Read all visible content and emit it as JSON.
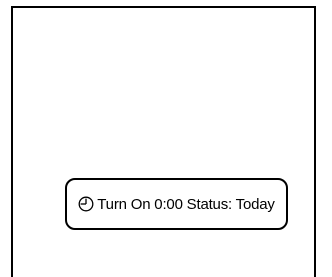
{
  "timer": {
    "icon": "clock-icon",
    "text": "Turn On 0:00 Status: Today"
  },
  "colors": {
    "foreground": "#000000",
    "background": "#ffffff"
  }
}
